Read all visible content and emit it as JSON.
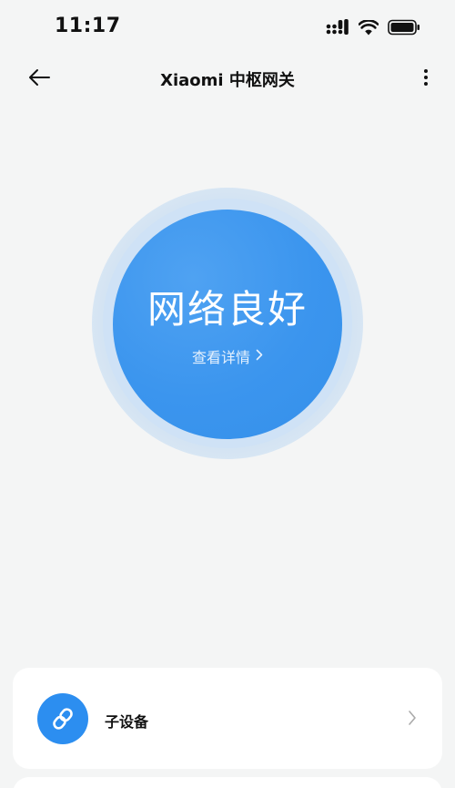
{
  "status_bar": {
    "time": "11:17",
    "icons": [
      "signal-icon",
      "wifi-icon",
      "battery-icon"
    ]
  },
  "header": {
    "title": "Xiaomi 中枢网关",
    "back_icon": "back-arrow-icon",
    "more_icon": "more-vertical-icon"
  },
  "network_status": {
    "label": "网络良好",
    "details_link": "查看详情"
  },
  "sub_devices": {
    "label": "子设备",
    "icon": "link-icon"
  },
  "colors": {
    "accent": "#3b95ee",
    "background": "#f4f5f5"
  }
}
